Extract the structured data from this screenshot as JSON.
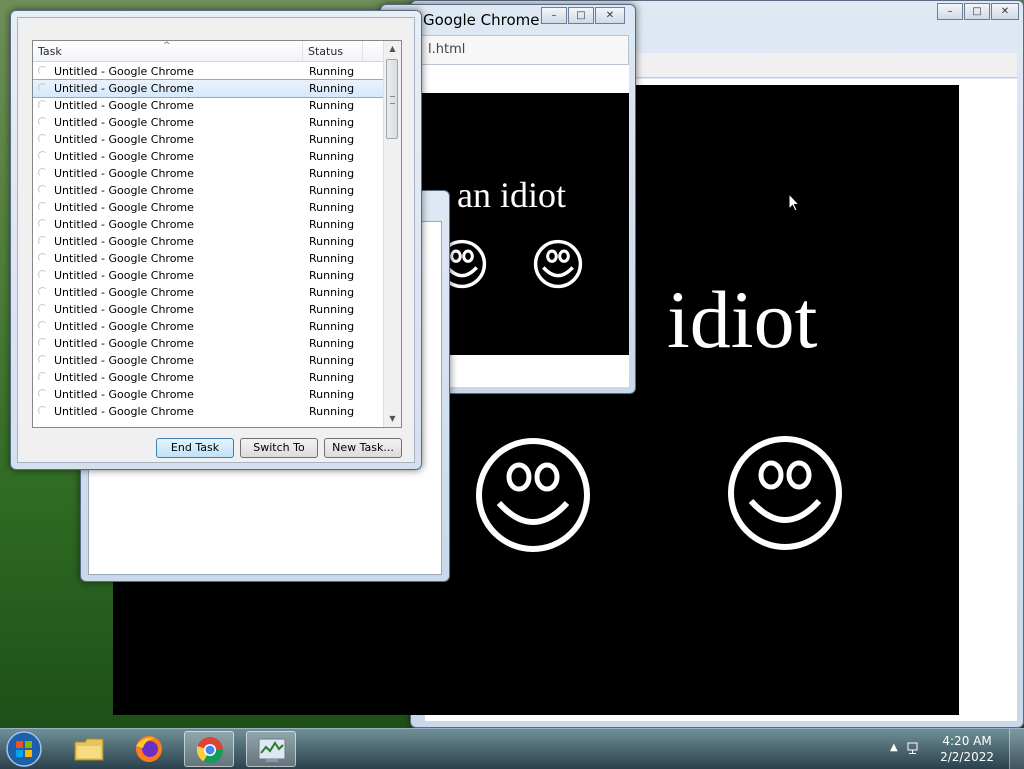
{
  "back_window": {
    "caption_buttons": [
      "–",
      "□",
      "✕"
    ],
    "content_text": "idiot"
  },
  "mid_window": {
    "title": "Google Chrome",
    "tab_text": "l.html",
    "content_text": "an idiot",
    "caption_buttons": [
      "–",
      "□",
      "✕"
    ]
  },
  "task_manager": {
    "columns": {
      "task": "Task",
      "status": "Status"
    },
    "sort_indicator": "^",
    "rows": [
      {
        "task": "Untitled - Google Chrome",
        "status": "Running"
      },
      {
        "task": "Untitled - Google Chrome",
        "status": "Running"
      },
      {
        "task": "Untitled - Google Chrome",
        "status": "Running"
      },
      {
        "task": "Untitled - Google Chrome",
        "status": "Running"
      },
      {
        "task": "Untitled - Google Chrome",
        "status": "Running"
      },
      {
        "task": "Untitled - Google Chrome",
        "status": "Running"
      },
      {
        "task": "Untitled - Google Chrome",
        "status": "Running"
      },
      {
        "task": "Untitled - Google Chrome",
        "status": "Running"
      },
      {
        "task": "Untitled - Google Chrome",
        "status": "Running"
      },
      {
        "task": "Untitled - Google Chrome",
        "status": "Running"
      },
      {
        "task": "Untitled - Google Chrome",
        "status": "Running"
      },
      {
        "task": "Untitled - Google Chrome",
        "status": "Running"
      },
      {
        "task": "Untitled - Google Chrome",
        "status": "Running"
      },
      {
        "task": "Untitled - Google Chrome",
        "status": "Running"
      },
      {
        "task": "Untitled - Google Chrome",
        "status": "Running"
      },
      {
        "task": "Untitled - Google Chrome",
        "status": "Running"
      },
      {
        "task": "Untitled - Google Chrome",
        "status": "Running"
      },
      {
        "task": "Untitled - Google Chrome",
        "status": "Running"
      },
      {
        "task": "Untitled - Google Chrome",
        "status": "Running"
      },
      {
        "task": "Untitled - Google Chrome",
        "status": "Running"
      },
      {
        "task": "Untitled - Google Chrome",
        "status": "Running"
      }
    ],
    "selected_row": 1,
    "buttons": {
      "end_task": "End Task",
      "switch_to": "Switch To",
      "new_task": "New Task..."
    }
  },
  "taskbar": {
    "pinned": [
      "file-explorer-icon",
      "firefox-icon",
      "chrome-icon",
      "task-manager-icon"
    ],
    "active_item": "chrome-icon",
    "clock": {
      "time": "4:20 AM",
      "date": "2/2/2022"
    }
  },
  "colors": {
    "selection": "#d6e8fb",
    "content_background": "#000000",
    "content_text": "#ffffff"
  }
}
